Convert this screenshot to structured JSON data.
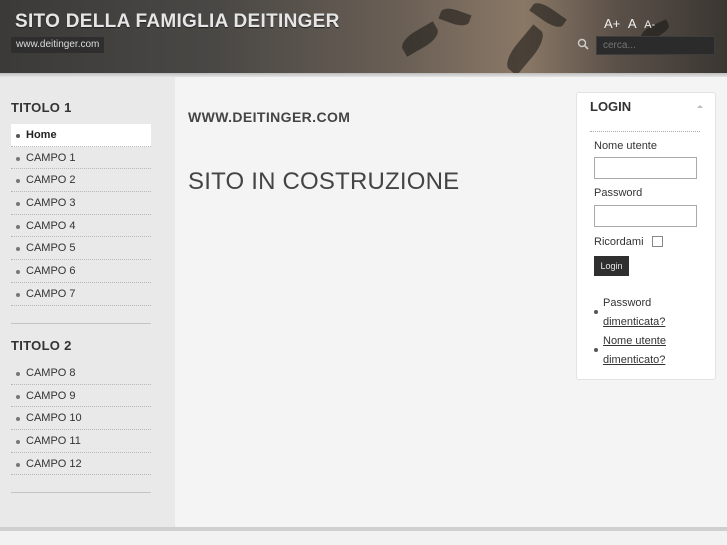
{
  "header": {
    "site_title": "SITO DELLA FAMIGLIA DEITINGER",
    "site_url": "www.deitinger.com",
    "font_tools": [
      "A+",
      "A",
      "A-"
    ],
    "search_placeholder": "cerca...",
    "search_icon": "search-icon"
  },
  "sidebar": {
    "menu1_title": "TITOLO 1",
    "menu1_items": [
      {
        "label": "Home"
      },
      {
        "label": "CAMPO 1"
      },
      {
        "label": "CAMPO 2"
      },
      {
        "label": "CAMPO 3"
      },
      {
        "label": "CAMPO 4"
      },
      {
        "label": "CAMPO 5"
      },
      {
        "label": "CAMPO 6"
      },
      {
        "label": "CAMPO 7"
      }
    ],
    "menu2_title": "TITOLO 2",
    "menu2_items": [
      {
        "label": "CAMPO 8"
      },
      {
        "label": "CAMPO 9"
      },
      {
        "label": "CAMPO 10"
      },
      {
        "label": "CAMPO 11"
      },
      {
        "label": "CAMPO 12"
      }
    ]
  },
  "main": {
    "heading": "WWW.DEITINGER.COM",
    "text": "SITO IN COSTRUZIONE"
  },
  "login": {
    "title": "LOGIN",
    "username_label": "Nome utente",
    "password_label": "Password",
    "remember_label": "Ricordami",
    "button_label": "Login",
    "forgot_password_prefix": "Password",
    "forgot_password_link": "dimenticata?",
    "forgot_username_link_1": "Nome utente",
    "forgot_username_link_2": "dimenticato?"
  },
  "colors": {
    "header_bg": "#4a4845",
    "sidebar_bg": "#e9e9e9",
    "main_bg": "#f4f4f4",
    "button_bg": "#2f2f2f"
  }
}
